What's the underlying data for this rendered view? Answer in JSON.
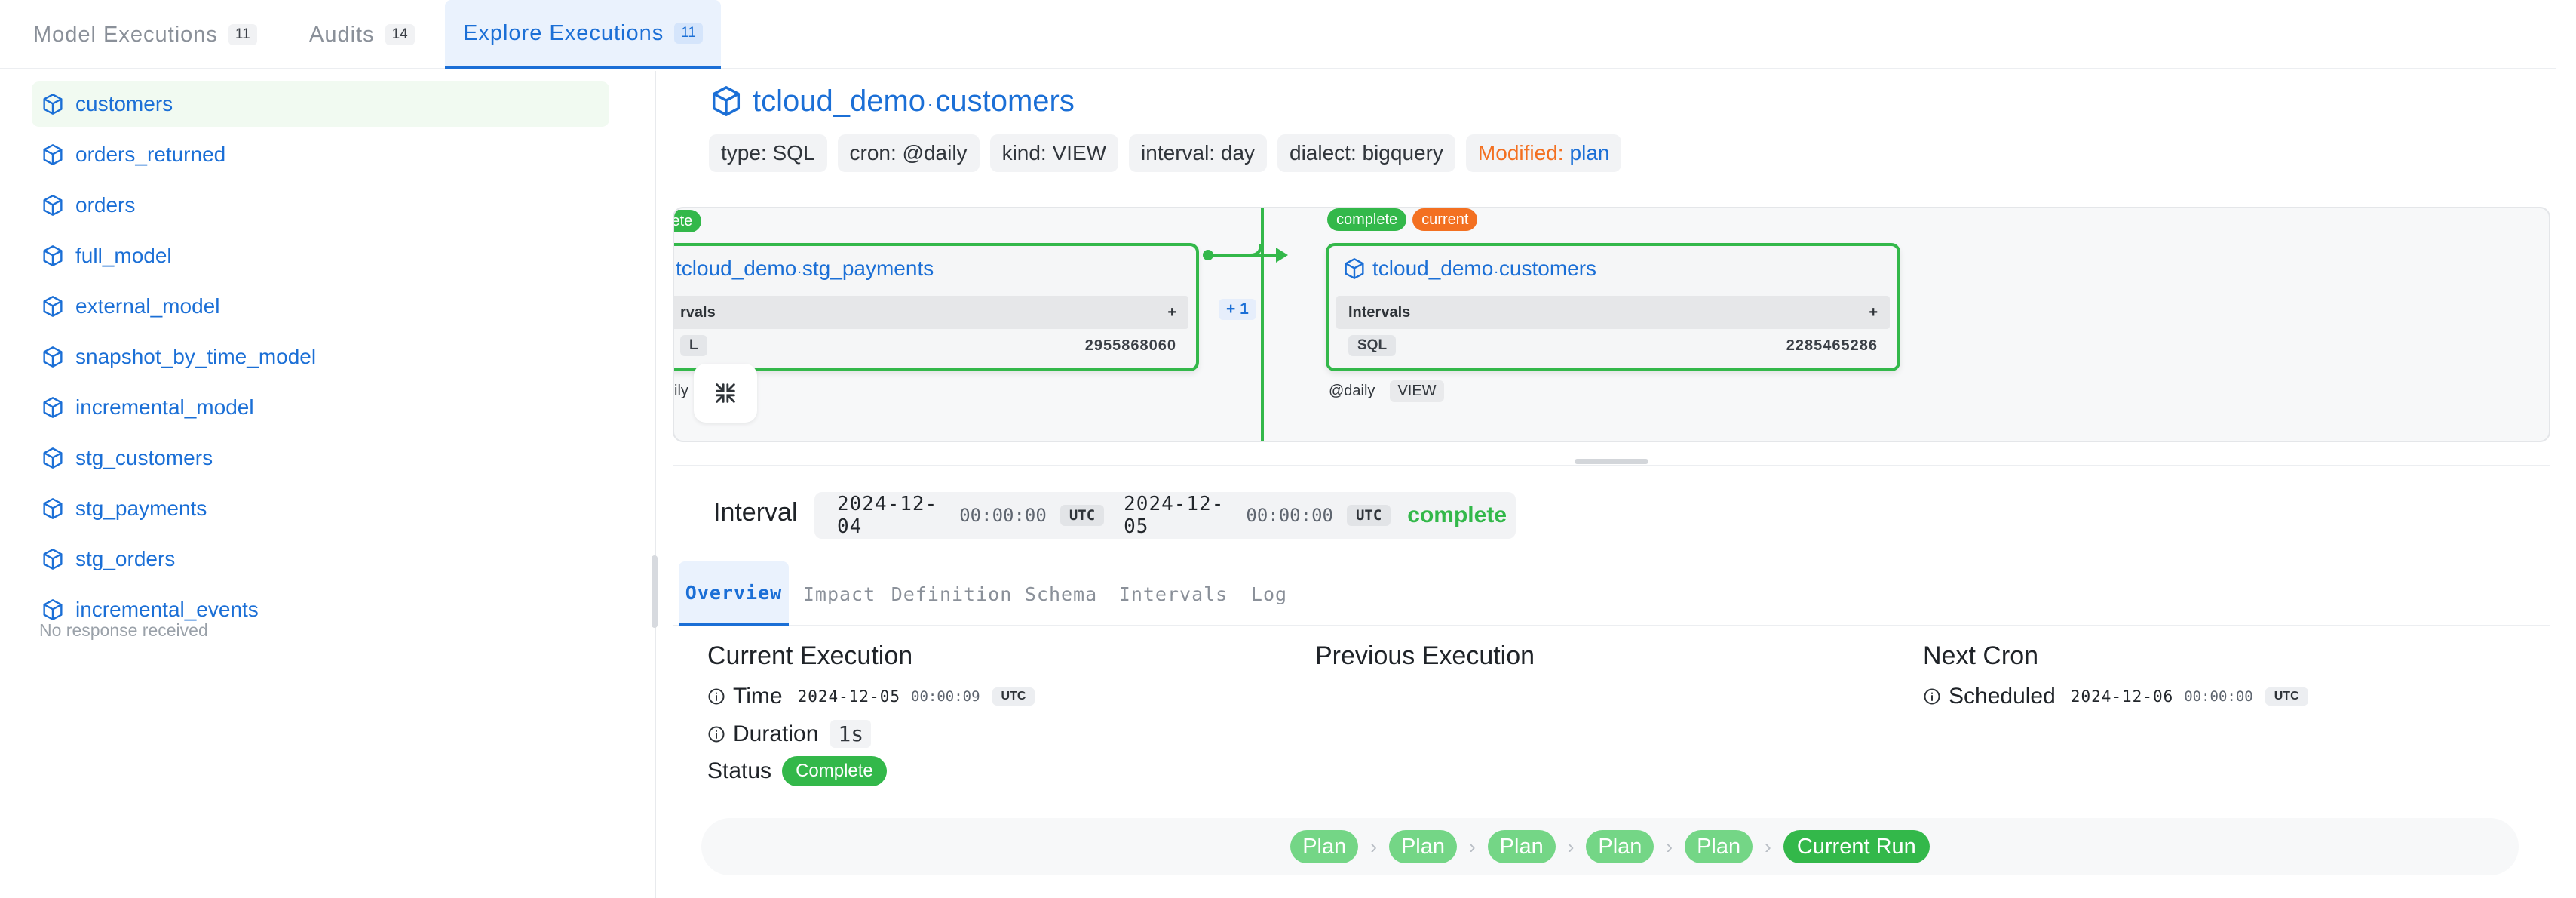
{
  "tabs": [
    {
      "label": "Model Executions",
      "count": "11"
    },
    {
      "label": "Audits",
      "count": "14"
    },
    {
      "label": "Explore Executions",
      "count": "11"
    }
  ],
  "sidebar": {
    "items": [
      "customers",
      "orders_returned",
      "orders",
      "full_model",
      "external_model",
      "snapshot_by_time_model",
      "incremental_model",
      "stg_customers",
      "stg_payments",
      "stg_orders",
      "incremental_events"
    ],
    "note": "No response received"
  },
  "model": {
    "schema": "tcloud_demo",
    "name": "customers",
    "chips": {
      "type": "type: SQL",
      "cron": "cron: @daily",
      "kind": "kind: VIEW",
      "interval": "interval: day",
      "dialect": "dialect: bigquery",
      "modified_label": "Modified:",
      "modified_value": "plan"
    }
  },
  "graph": {
    "left_node": {
      "badge": "lete",
      "schema": "tcloud_demo",
      "name": "stg_payments",
      "intervals_label": "rvals",
      "plus": "+",
      "sql_label": "L",
      "number": "2955868060",
      "footer": "ily"
    },
    "plus_one": "+ 1",
    "right_node": {
      "badges": [
        "complete",
        "current"
      ],
      "schema": "tcloud_demo",
      "name": "customers",
      "intervals_label": "Intervals",
      "plus": "+",
      "sql_label": "SQL",
      "number": "2285465286",
      "footer_cron": "@daily",
      "footer_kind": "VIEW"
    }
  },
  "interval": {
    "label": "Interval",
    "start_date": "2024-12-04",
    "start_time": "00:00:00",
    "start_tz": "UTC",
    "end_date": "2024-12-05",
    "end_time": "00:00:00",
    "end_tz": "UTC",
    "status": "complete"
  },
  "detail_tabs": [
    "Overview",
    "Impact",
    "Definition",
    "Schema",
    "Intervals",
    "Log"
  ],
  "overview": {
    "current": {
      "heading": "Current Execution",
      "time_label": "Time",
      "time_date": "2024-12-05",
      "time_time": "00:00:09",
      "time_tz": "UTC",
      "duration_label": "Duration",
      "duration_value": "1s",
      "status_label": "Status",
      "status_value": "Complete"
    },
    "previous": {
      "heading": "Previous Execution"
    },
    "next": {
      "heading": "Next Cron",
      "scheduled_label": "Scheduled",
      "date": "2024-12-06",
      "time": "00:00:00",
      "tz": "UTC"
    }
  },
  "breadcrumbs": [
    "Plan",
    "Plan",
    "Plan",
    "Plan",
    "Plan",
    "Current Run"
  ],
  "colors": {
    "accent": "#1b6fd6",
    "success": "#33b84a",
    "warning": "#f37021"
  },
  "icons": {
    "model": "cube-icon",
    "info": "info-circle-icon",
    "collapse": "collapse-arrows-icon",
    "separator": "chevron-right-icon"
  }
}
